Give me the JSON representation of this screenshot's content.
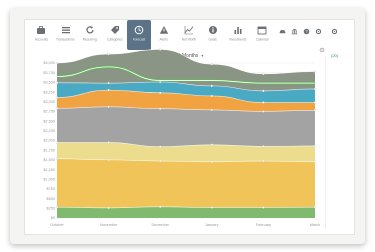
{
  "toolbar": {
    "items": [
      {
        "label": "Accounts",
        "icon": "briefcase-icon"
      },
      {
        "label": "Transactions",
        "icon": "list-icon"
      },
      {
        "label": "Recurring",
        "icon": "refresh-icon"
      },
      {
        "label": "Categories",
        "icon": "tags-icon"
      },
      {
        "label": "Forecast",
        "icon": "clock-icon",
        "active": true
      },
      {
        "label": "Alerts",
        "icon": "warning-icon"
      },
      {
        "label": "Net Worth",
        "icon": "trend-line-icon"
      },
      {
        "label": "Goals",
        "icon": "info-circle-icon"
      },
      {
        "label": "Investments",
        "icon": "bar-chart-icon"
      },
      {
        "label": "Calendar",
        "icon": "calendar-icon"
      }
    ],
    "right_icons": [
      "car-icon",
      "bank-icon",
      "help-icon",
      "gear-icon"
    ],
    "far_right_icon": "gear-icon"
  },
  "period": {
    "label": "Previous 6 Months",
    "caret": "▾"
  },
  "side_panel": {
    "link_label": "(20)",
    "icon": "gear-icon"
  },
  "colors": {
    "accent": "#5c7287",
    "series": [
      "#7fba6e",
      "#f1c45a",
      "#ecdd8e",
      "#a3a3a3",
      "#f0a340",
      "#4aa9c3",
      "#8a9585",
      "#5cbd54"
    ]
  },
  "chart_data": {
    "type": "area",
    "stacked": true,
    "x": [
      "October",
      "November",
      "December",
      "January",
      "February",
      "March"
    ],
    "y_ticks": [
      "$0",
      "$250",
      "$500",
      "$750",
      "$1,000",
      "$1,250",
      "$1,500",
      "$1,750",
      "$2,000",
      "$2,250",
      "$2,500",
      "$2,750",
      "$3,000",
      "$3,250",
      "$3,500",
      "$3,750",
      "$4,000"
    ],
    "ylim": [
      0,
      4000
    ],
    "grid": true,
    "legend": "none",
    "series": [
      {
        "values": [
          280,
          260,
          290,
          270,
          270,
          280
        ]
      },
      {
        "values": [
          1250,
          1240,
          1180,
          1180,
          1200,
          1170
        ]
      },
      {
        "values": [
          420,
          450,
          370,
          440,
          380,
          410
        ]
      },
      {
        "values": [
          880,
          920,
          980,
          900,
          900,
          920
        ]
      },
      {
        "values": [
          280,
          430,
          410,
          360,
          230,
          200
        ]
      },
      {
        "values": [
          380,
          180,
          280,
          260,
          300,
          350
        ]
      },
      {
        "values": [
          510,
          750,
          840,
          560,
          440,
          450
        ]
      }
    ],
    "line": {
      "values": [
        3650,
        3900,
        3550,
        3550,
        3480,
        3480
      ]
    }
  }
}
